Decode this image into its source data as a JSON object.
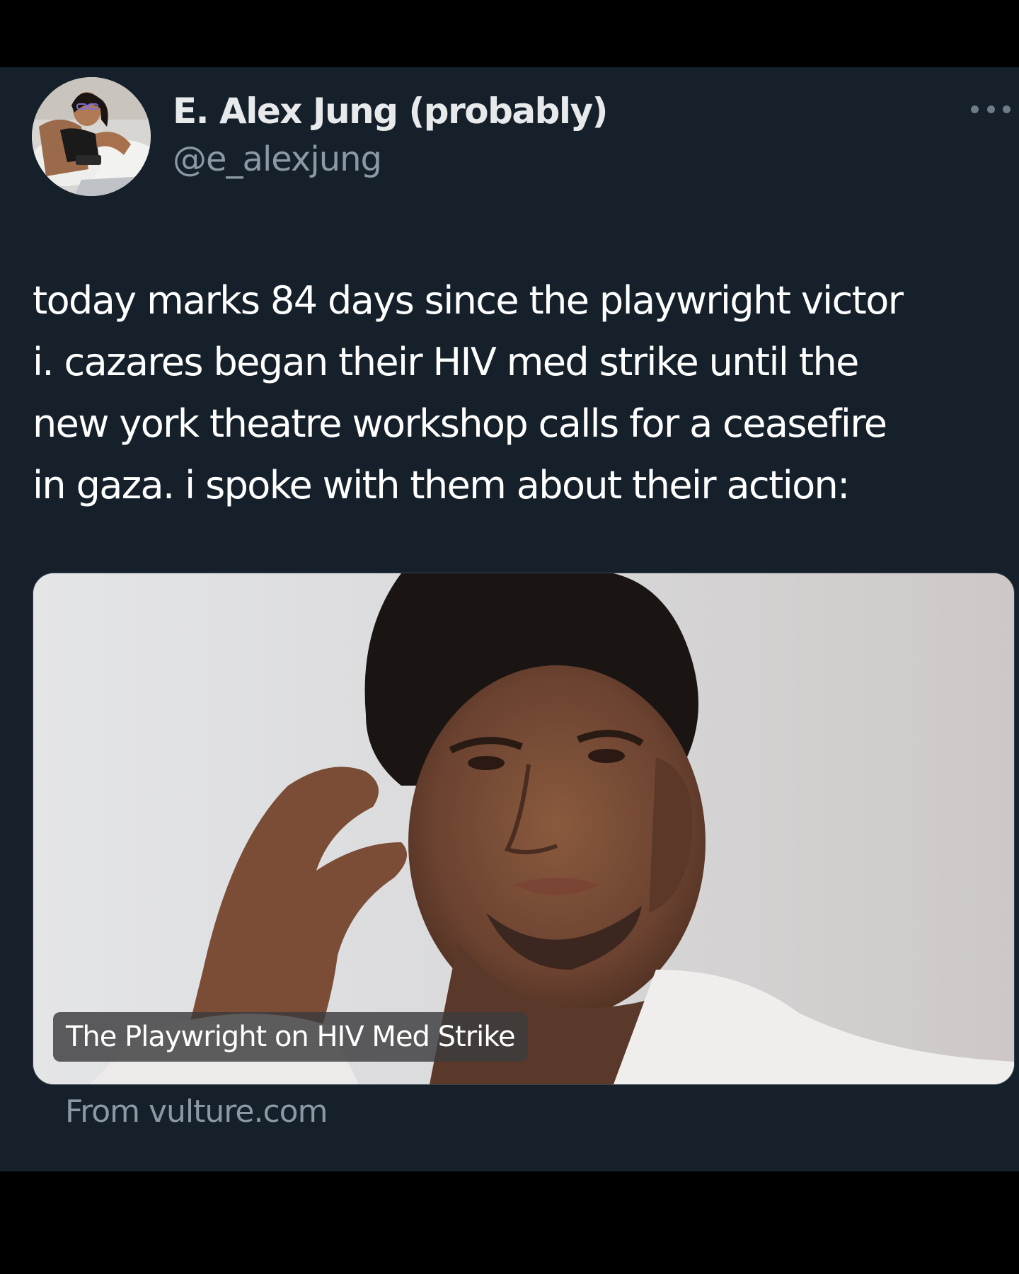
{
  "tweet": {
    "author": {
      "display_name": "E. Alex Jung (probably)",
      "handle": "@e_alexjung"
    },
    "more_icon": "more-horizontal-icon",
    "text_lines": [
      "today marks 84 days since the playwright victor",
      "i. cazares began their HIV med strike until the",
      "new york theatre workshop calls for a ceasefire",
      "in gaza. i spoke with them about their action:"
    ],
    "link_card": {
      "title": "The Playwright on HIV Med Strike",
      "source": "From vulture.com"
    }
  },
  "colors": {
    "background": "#15202b",
    "outer": "#000000",
    "primary_text": "#ffffff",
    "secondary_text": "#8b98a5"
  }
}
